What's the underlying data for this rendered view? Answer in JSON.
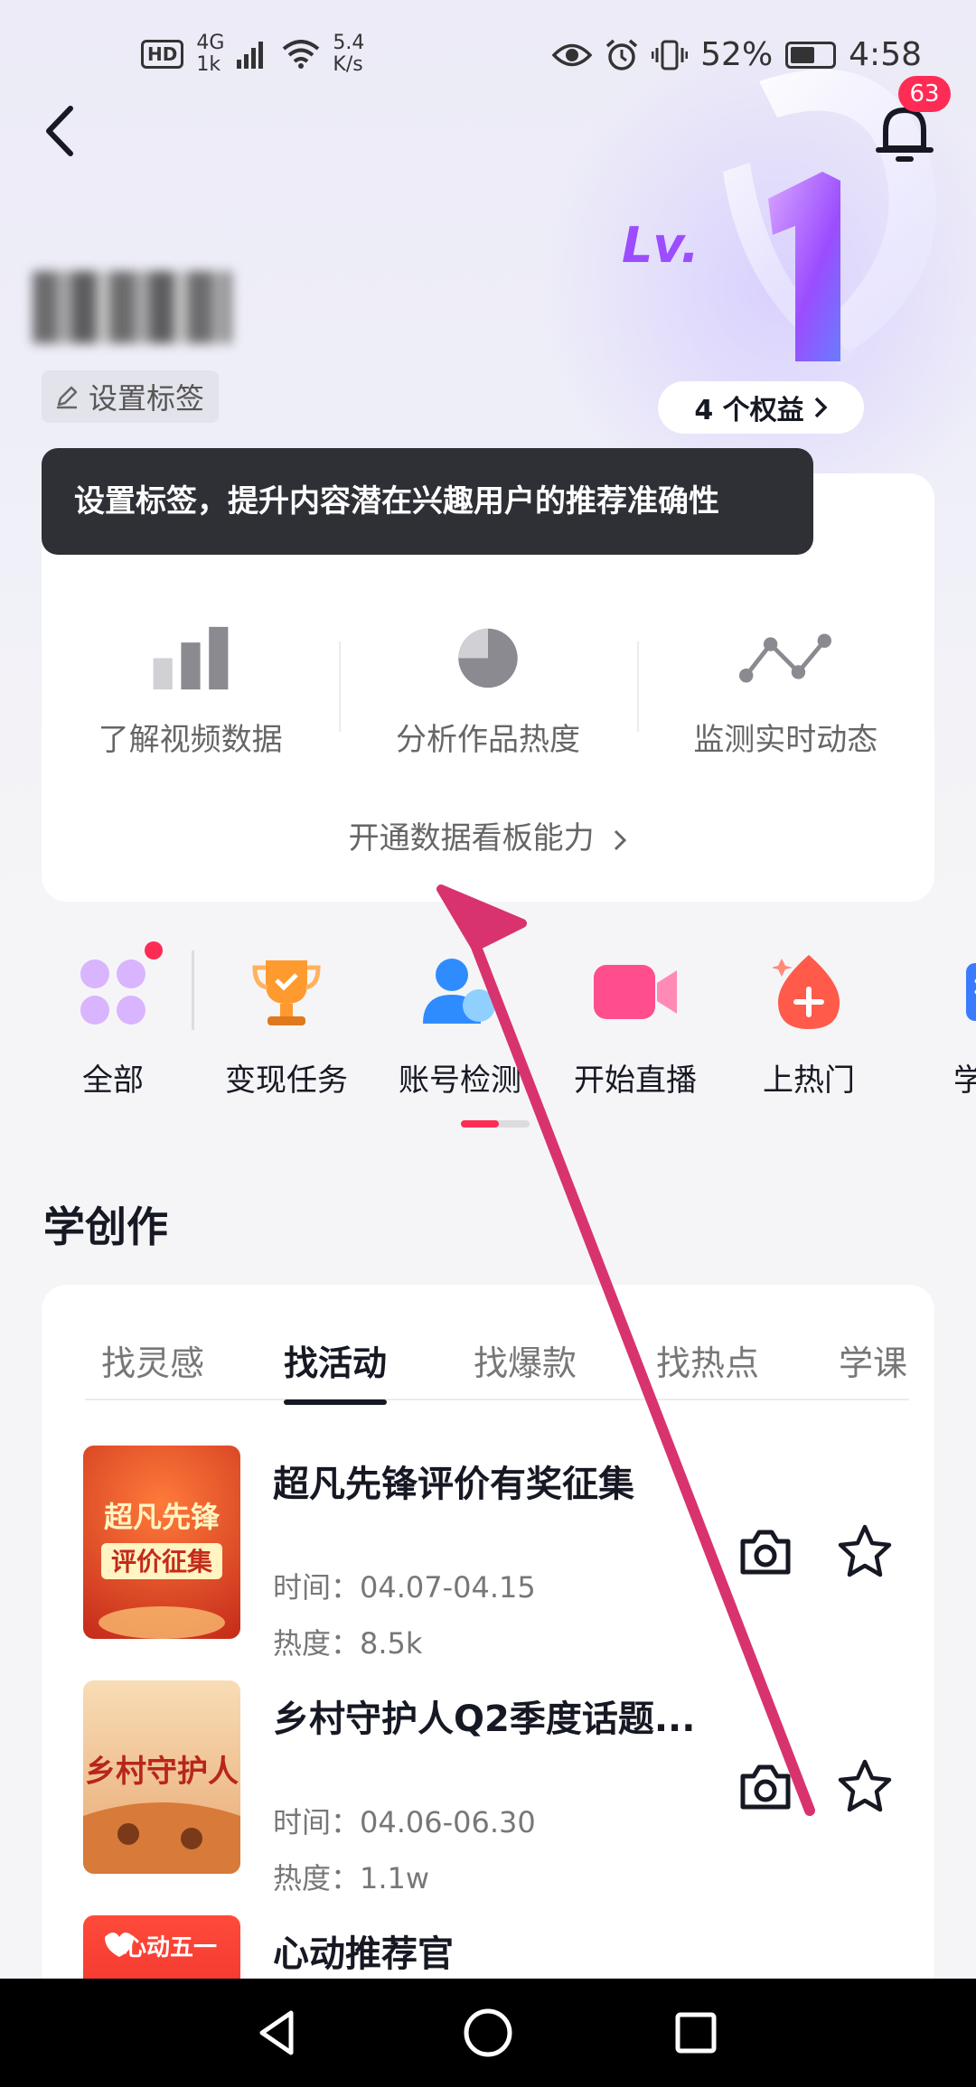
{
  "status_bar": {
    "hd": "HD",
    "network": "4G",
    "network_sub": "1k",
    "speed_value": "5.4",
    "speed_unit": "K/s",
    "battery": "52%",
    "time": "4:58"
  },
  "header": {
    "notification_count": "63",
    "level_label": "Lv.",
    "level_value": "1",
    "rights_label": "4 个权益",
    "set_tag_label": "设置标签"
  },
  "tooltip": {
    "text": "设置标签，提升内容潜在兴趣用户的推荐准确性"
  },
  "data_card": {
    "features": [
      {
        "label": "了解视频数据",
        "icon": "bar-chart-icon"
      },
      {
        "label": "分析作品热度",
        "icon": "pie-chart-icon"
      },
      {
        "label": "监测实时动态",
        "icon": "line-chart-icon"
      }
    ],
    "open_label": "开通数据看板能力"
  },
  "shortcuts": [
    {
      "label": "全部",
      "icon": "grid-icon"
    },
    {
      "label": "变现任务",
      "icon": "trophy-icon"
    },
    {
      "label": "账号检测",
      "icon": "account-check-icon"
    },
    {
      "label": "开始直播",
      "icon": "live-camera-icon"
    },
    {
      "label": "上热门",
      "icon": "flame-icon"
    },
    {
      "label": "学习",
      "icon": "book-icon"
    }
  ],
  "learn": {
    "title": "学创作",
    "tabs": [
      {
        "label": "找灵感"
      },
      {
        "label": "找活动"
      },
      {
        "label": "找爆款"
      },
      {
        "label": "找热点"
      },
      {
        "label": "学课"
      }
    ],
    "active_tab": "找活动",
    "activities": [
      {
        "title": "超凡先锋评价有奖征集",
        "time": "时间：04.07-04.15",
        "heat": "热度：8.5k",
        "thumb_text": "超凡先锋\n评价征集",
        "thumb_color": "#e84a2f"
      },
      {
        "title": "乡村守护人Q2季度话题...",
        "time": "时间：04.06-06.30",
        "heat": "热度：1.1w",
        "thumb_text": "乡村守护人",
        "thumb_color": "#f2c79a"
      },
      {
        "title": "心动推荐官",
        "time": "",
        "heat": "",
        "thumb_text": "心动五一",
        "thumb_color": "#f23b3b"
      }
    ]
  },
  "colors": {
    "accent": "#fe2c55",
    "arrow": "#d8336f",
    "text_primary": "#161823",
    "text_secondary": "#666666"
  }
}
